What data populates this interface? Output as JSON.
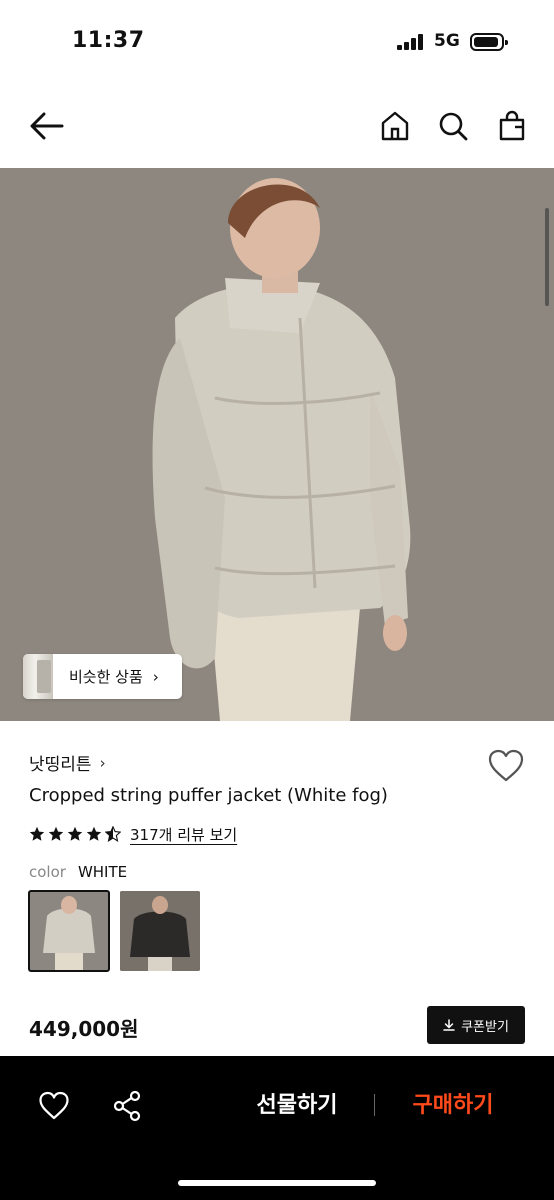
{
  "status": {
    "time": "11:37",
    "network": "5G"
  },
  "nav": {
    "back_icon": "arrow-left-icon",
    "home_icon": "home-icon",
    "search_icon": "search-icon",
    "bag_icon": "shopping-bag-icon"
  },
  "hero": {
    "similar_button": {
      "label": "비슷한 상품",
      "chevron": "›"
    }
  },
  "product": {
    "brand": "낫띵리튼",
    "brand_chevron": "›",
    "title": "Cropped string puffer jacket (White fog)",
    "rating_stars": 4.5,
    "review_link": "317개 리뷰 보기",
    "color_label": "color",
    "color_value": "WHITE",
    "swatches": [
      {
        "color_hint": "white",
        "selected": true
      },
      {
        "color_hint": "black",
        "selected": false
      }
    ],
    "price": "449,000원",
    "coupon_label": "쿠폰받기"
  },
  "bottom_bar": {
    "gift_label": "선물하기",
    "buy_label": "구매하기",
    "buy_color": "#ff4a1c"
  }
}
